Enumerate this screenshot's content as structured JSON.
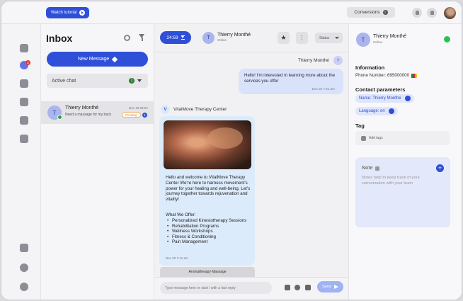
{
  "topbar": {
    "watch_tutorial": "Watch tutorial",
    "conversions": "Conversions"
  },
  "nav": {
    "badge": "2"
  },
  "inbox": {
    "title": "Inbox",
    "new_message": "New Message",
    "active_chat": "Active chat",
    "active_count": "1",
    "conversations": [
      {
        "initial": "T",
        "name": "Thierry Monthé",
        "date": "Dec 10 09:04",
        "snippet": "Need a massage for my back",
        "status": "Pending",
        "unread": "1"
      }
    ]
  },
  "chat": {
    "timer": "24:59",
    "contact_initial": "T",
    "contact_name": "Thierry Monthé",
    "contact_status": "Online",
    "status_select": "Status",
    "outgoing": {
      "sender": "Thierry Monthé",
      "initial": "T",
      "text": "Hello! I'm interested in learning more about the services you offer",
      "time": "Dec 20 7:41 am"
    },
    "incoming": {
      "logo": "V",
      "sender": "VitalMove Therapy Center",
      "text": "Hello and welcome to VitalMove Therapy Center We're here to harness movement's power for your healing and well-being. Let's journey together towards rejuvenation and vitality!",
      "offer_heading": "What We Offer:",
      "services": [
        "Personalized Kinesiotherapy Sessions",
        "Rehabilitation Programs",
        "Wellness Workshops",
        "Fitness & Conditioning",
        "Pain Management"
      ],
      "time": "Dec 20 7:41 am"
    },
    "quick_reply": "Aromatherapy Massage",
    "composer_placeholder": "Type message here or start / with a fast reply",
    "send": "Send"
  },
  "contact": {
    "initial": "T",
    "name": "Thierry Monthé",
    "status": "Online",
    "information_heading": "Information",
    "phone": "Phone Number: 695000000",
    "params_heading": "Contact parameters",
    "param_name": "Name: Thierry Monthé",
    "param_language": "Language: en",
    "tag_heading": "Tag",
    "add_tags": "Add tags",
    "note_title": "Note",
    "note_text": "Notes help to keep track of your conversation with your team"
  }
}
